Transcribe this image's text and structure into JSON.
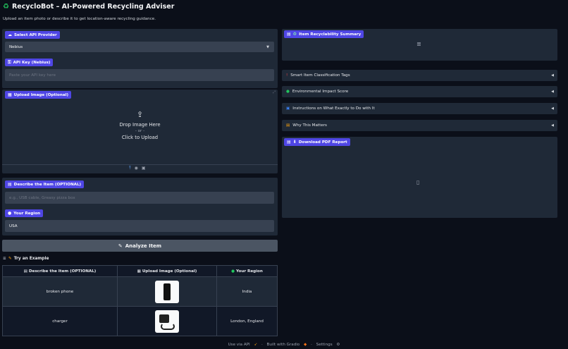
{
  "app": {
    "title": "RecycloBot – AI-Powered Recycling Adviser",
    "subtitle": "Upload an item photo or describe it to get location-aware recycling guidance."
  },
  "left": {
    "provider": {
      "label": "Select API Provider",
      "value": "Nebius"
    },
    "api_key": {
      "label": "API Key (Nebius)",
      "placeholder": "Paste your API key here"
    },
    "upload": {
      "label": "Upload Image (Optional)",
      "drop_text": "Drop Image Here",
      "or_text": "- or -",
      "click_text": "Click to Upload"
    },
    "describe": {
      "label": "Describe the Item (OPTIONAL)",
      "placeholder": "e.g., USB cable, Greasy pizza box"
    },
    "region": {
      "label": "Your Region",
      "value": "USA"
    },
    "analyze_label": "Analyze Item"
  },
  "examples": {
    "label": "Try an Example",
    "headers": [
      "Describe the Item (OPTIONAL)",
      "Upload Image (Optional)",
      "Your Region"
    ],
    "rows": [
      {
        "item": "broken phone",
        "region": "India"
      },
      {
        "item": "charger",
        "region": "London, England"
      }
    ]
  },
  "right": {
    "summary_label": "Item Recyclability Summary",
    "accordions": [
      "Smart Item Classification Tags",
      "Environmental Impact Score",
      "Instructions on What Exactly to Do with It",
      "Why This Matters"
    ],
    "pdf_label": "Download PDF Report"
  },
  "footer": {
    "api": "Use via API",
    "built": "Built with Gradio",
    "settings": "Settings",
    "sep": "·"
  },
  "colors": {
    "accent": "#4f46e5",
    "bg": "#0b0f19",
    "panel": "#1f2937",
    "field": "#374151"
  }
}
